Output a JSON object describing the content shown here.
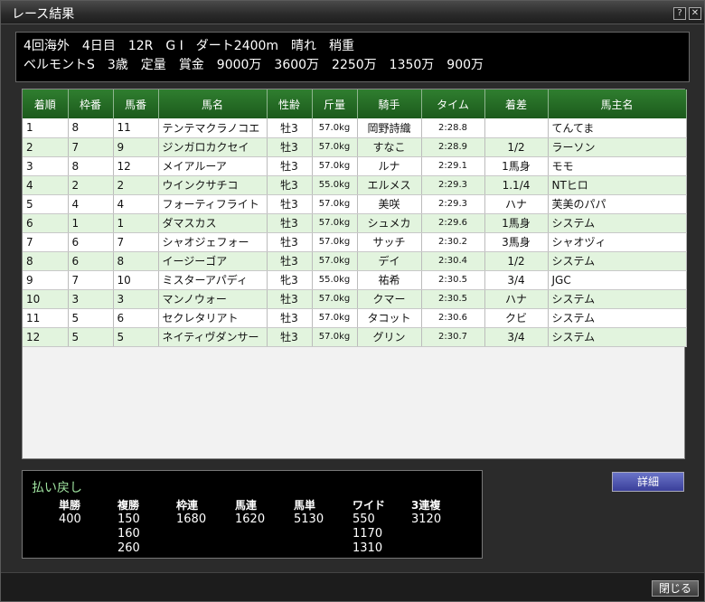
{
  "window": {
    "title": "レース結果",
    "help_label": "?",
    "close_label": "✕"
  },
  "race": {
    "line1": "4回海外　4日目　12R　G Ⅰ　ダート2400m　晴れ　稍重",
    "line2": "ベルモントS　3歳　定量　賞金　9000万　3600万　2250万　1350万　900万"
  },
  "table": {
    "headers": [
      "着順",
      "枠番",
      "馬番",
      "馬名",
      "性齢",
      "斤量",
      "騎手",
      "タイム",
      "着差",
      "馬主名"
    ],
    "rows": [
      [
        "1",
        "8",
        "11",
        "テンテマクラノコエ",
        "牡3",
        "57.0kg",
        "岡野詩織",
        "2:28.8",
        "",
        "てんてま"
      ],
      [
        "2",
        "7",
        "9",
        "ジンガロカクセイ",
        "牡3",
        "57.0kg",
        "すなこ",
        "2:28.9",
        "1/2",
        "ラーソン"
      ],
      [
        "3",
        "8",
        "12",
        "メイアルーア",
        "牡3",
        "57.0kg",
        "ルナ",
        "2:29.1",
        "1馬身",
        "モモ"
      ],
      [
        "4",
        "2",
        "2",
        "ウインクサチコ",
        "牝3",
        "55.0kg",
        "エルメス",
        "2:29.3",
        "1.1/4",
        "NTヒロ"
      ],
      [
        "5",
        "4",
        "4",
        "フォーティフライト",
        "牡3",
        "57.0kg",
        "美咲",
        "2:29.3",
        "ハナ",
        "芙美のパパ"
      ],
      [
        "6",
        "1",
        "1",
        "ダマスカス",
        "牡3",
        "57.0kg",
        "シュメカ",
        "2:29.6",
        "1馬身",
        "システム"
      ],
      [
        "7",
        "6",
        "7",
        "シャオジェフォー",
        "牡3",
        "57.0kg",
        "サッチ",
        "2:30.2",
        "3馬身",
        "シャオヅィ"
      ],
      [
        "8",
        "6",
        "8",
        "イージーゴア",
        "牡3",
        "57.0kg",
        "デイ",
        "2:30.4",
        "1/2",
        "システム"
      ],
      [
        "9",
        "7",
        "10",
        "ミスターアパディ",
        "牝3",
        "55.0kg",
        "祐希",
        "2:30.5",
        "3/4",
        "JGC"
      ],
      [
        "10",
        "3",
        "3",
        "マンノウォー",
        "牡3",
        "57.0kg",
        "クマー",
        "2:30.5",
        "ハナ",
        "システム"
      ],
      [
        "11",
        "5",
        "6",
        "セクレタリアト",
        "牡3",
        "57.0kg",
        "タコット",
        "2:30.6",
        "クビ",
        "システム"
      ],
      [
        "12",
        "5",
        "5",
        "ネイティヴダンサー",
        "牡3",
        "57.0kg",
        "グリン",
        "2:30.7",
        "3/4",
        "システム"
      ]
    ]
  },
  "payout": {
    "title": "払い戻し",
    "columns": [
      {
        "label": "単勝",
        "values": [
          "400"
        ]
      },
      {
        "label": "複勝",
        "values": [
          "150",
          "160",
          "260"
        ]
      },
      {
        "label": "枠連",
        "values": [
          "1680"
        ]
      },
      {
        "label": "馬連",
        "values": [
          "1620"
        ]
      },
      {
        "label": "馬単",
        "values": [
          "5130"
        ]
      },
      {
        "label": "ワイド",
        "values": [
          "550",
          "1170",
          "1310"
        ]
      },
      {
        "label": "3連複",
        "values": [
          "3120"
        ]
      }
    ]
  },
  "buttons": {
    "detail": "詳細",
    "close": "閉じる"
  }
}
